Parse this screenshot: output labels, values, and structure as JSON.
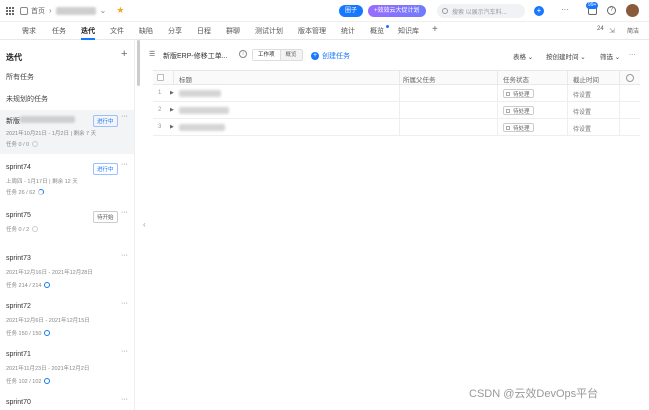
{
  "topbar": {
    "crumb_home": "首页",
    "btn_meeting": "圈子",
    "btn_event": "+效效云大促计划",
    "search_placeholder": "搜索 以展示汽车料...",
    "more": "···",
    "notif_badge": "99+",
    "help": "?"
  },
  "tabs": {
    "items": [
      "需求",
      "任务",
      "迭代",
      "文件",
      "缺陷",
      "分享",
      "日程",
      "群聊",
      "测试计划",
      "版本管理",
      "统计",
      "概览",
      "知识库"
    ],
    "active": "迭代",
    "add": "+",
    "count": "24",
    "fold_label": "简洁"
  },
  "sidebar": {
    "title": "迭代",
    "add": "+",
    "links": [
      "所有任务",
      "未规划的任务"
    ],
    "sprints": [
      {
        "name": "新版",
        "badge": "进行中",
        "date": "2021年10月21日 - 1月2日",
        "remain": "剩余 7 天",
        "tasks": "任务 0 / 0",
        "ring": "empty",
        "selected": true
      },
      {
        "name": "sprint74",
        "badge": "进行中",
        "date": "上周四 - 1月17日",
        "remain": "剩余 12 天",
        "tasks": "任务 26 / 62",
        "ring": "part"
      },
      {
        "name": "sprint75",
        "badge": "待开始",
        "date": "",
        "remain": "",
        "tasks": "任务 0 / 2",
        "ring": "empty",
        "badge_gray": true
      },
      {
        "name": "sprint73",
        "badge": "",
        "date": "2021年12月16日 - 2021年12月28日",
        "remain": "",
        "tasks": "任务 214 / 214",
        "ring": "full"
      },
      {
        "name": "sprint72",
        "badge": "",
        "date": "2021年12月6日 - 2021年12月15日",
        "remain": "",
        "tasks": "任务 150 / 150",
        "ring": "full"
      },
      {
        "name": "sprint71",
        "badge": "",
        "date": "2021年11月23日 - 2021年12月2日",
        "remain": "",
        "tasks": "任务 102 / 102",
        "ring": "full"
      },
      {
        "name": "sprint70",
        "badge": "",
        "date": "",
        "remain": "",
        "tasks": "",
        "ring": ""
      }
    ]
  },
  "toolbar": {
    "title": "新版ERP-修移工单...",
    "seg_on": "工作项",
    "seg_off": "概览",
    "create": "创建任务",
    "view": "表格",
    "sort": "按创建时间",
    "filter": "筛选",
    "more": "···"
  },
  "table": {
    "headers": {
      "title": "标题",
      "parent": "所属父任务",
      "status": "任务状态",
      "deadline": "截止时间"
    },
    "rows": [
      {
        "n": "1",
        "status": "待处理",
        "deadline": "待设置"
      },
      {
        "n": "2",
        "status": "待处理",
        "deadline": "待设置"
      },
      {
        "n": "3",
        "status": "待处理",
        "deadline": "待设置"
      }
    ]
  },
  "watermark": "CSDN @云效DevOps平台"
}
